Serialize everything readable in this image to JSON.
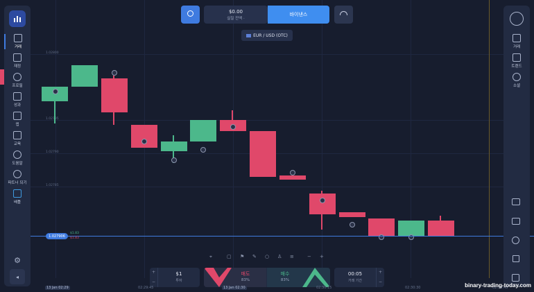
{
  "header": {
    "balance_value": "$0.00",
    "balance_label": "실질 잔액 ·",
    "deposit_label": "바이낸스",
    "asset_pair": "EUR / USD (OTC)"
  },
  "sidebar_left": {
    "items": [
      {
        "label": "거래",
        "icon": "chart-icon"
      },
      {
        "label": "재정",
        "icon": "finance-icon"
      },
      {
        "label": "프로필",
        "icon": "user-icon"
      },
      {
        "label": "성과",
        "icon": "trophy-icon"
      },
      {
        "label": "앱",
        "icon": "grid-icon"
      },
      {
        "label": "교육",
        "icon": "book-icon"
      },
      {
        "label": "도움말",
        "icon": "info-icon"
      },
      {
        "label": "파트너 되기",
        "icon": "heart-icon"
      },
      {
        "label": "배틀",
        "icon": "battle-icon"
      }
    ]
  },
  "sidebar_right": {
    "items": [
      {
        "label": "거래",
        "icon": "chart-icon"
      },
      {
        "label": "트렌드",
        "icon": "lightning-icon"
      },
      {
        "label": "소셜",
        "icon": "people-icon"
      }
    ]
  },
  "chart": {
    "price_tag": "1.027906",
    "y_labels": [
      "1.02800",
      "1.02795",
      "1.02790",
      "1.02785"
    ],
    "time_labels": [
      "13 Jan 02:29",
      "02:29:45",
      "13 Jan 02:30",
      "02:30:15",
      "02:30:30",
      "02:30:45"
    ],
    "right_ticks": [
      "$1.83",
      "$1.83"
    ]
  },
  "bottom_bar": {
    "amount_value": "$1",
    "amount_label": "투자",
    "sell_label": "매도",
    "sell_percent": "83%",
    "buy_label": "매수",
    "buy_percent": "83%",
    "time_value": "00:05",
    "time_label": "거래 기간"
  },
  "watermark": "binary-trading-today.com",
  "colors": {
    "up": "#4cb88b",
    "down": "#e0486a",
    "accent": "#3f7be0",
    "panel": "#222b42",
    "background": "#171d2e"
  }
}
